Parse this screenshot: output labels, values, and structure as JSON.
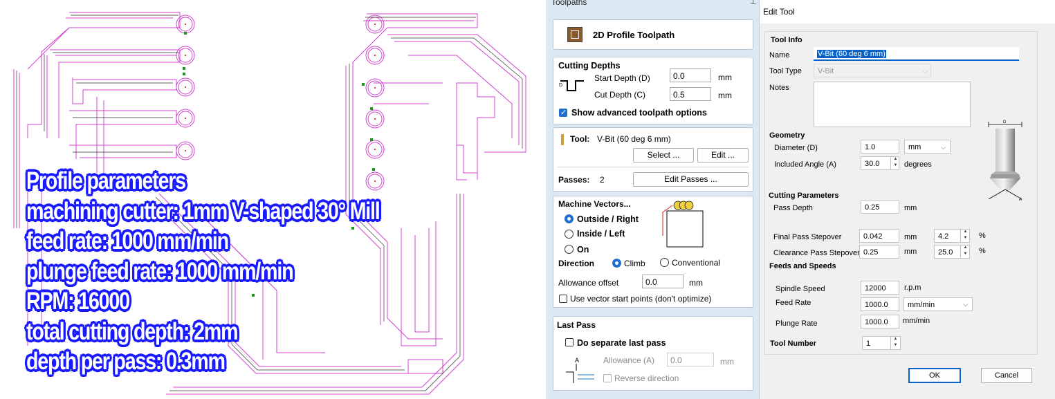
{
  "overlay": {
    "lines": [
      "Profile parameters",
      "machining cutter: 1mm V-shaped 30° Mill",
      "feed rate: 1000 mm/min",
      "plunge feed rate: 1000 mm/min",
      "RPM: 16000",
      "total cutting depth: 2mm",
      "depth per pass: 0.3mm"
    ]
  },
  "toolpaths": {
    "title": "Toolpaths",
    "header_button": "2D Profile Toolpath",
    "cutting_depths": {
      "heading": "Cutting Depths",
      "start_depth_label": "Start Depth (D)",
      "start_depth_value": "0.0",
      "cut_depth_label": "Cut Depth (C)",
      "cut_depth_value": "0.5",
      "unit": "mm",
      "advanced_label": "Show advanced toolpath options",
      "advanced_checked": true
    },
    "tool": {
      "label": "Tool:",
      "value": "V-Bit (60 deg 6 mm)",
      "select_button": "Select ...",
      "edit_button": "Edit ...",
      "passes_label": "Passes:",
      "passes_value": "2",
      "edit_passes_button": "Edit Passes ..."
    },
    "machine_vectors": {
      "heading": "Machine Vectors...",
      "outside": "Outside / Right",
      "inside": "Inside / Left",
      "on": "On",
      "direction_label": "Direction",
      "climb": "Climb",
      "conventional": "Conventional",
      "allowance_label": "Allowance offset",
      "allowance_value": "0.0",
      "unit": "mm",
      "vector_start_label": "Use vector start points (don't optimize)"
    },
    "last_pass": {
      "heading": "Last Pass",
      "separate_label": "Do separate last pass",
      "allowance_label": "Allowance (A)",
      "allowance_value": "0.0",
      "unit": "mm",
      "reverse_label": "Reverse direction"
    }
  },
  "edit_tool": {
    "title": "Edit Tool",
    "tool_info": {
      "heading": "Tool Info",
      "name_label": "Name",
      "name_value": "V-Bit (60 deg 6 mm)",
      "type_label": "Tool Type",
      "type_value": "V-Bit",
      "notes_label": "Notes"
    },
    "geometry": {
      "heading": "Geometry",
      "diameter_label": "Diameter (D)",
      "diameter_value": "1.0",
      "diameter_unit": "mm",
      "angle_label": "Included Angle (A)",
      "angle_value": "30.0",
      "angle_unit": "degrees",
      "diagram_d": "D",
      "diagram_a": "A"
    },
    "cutting_parameters": {
      "heading": "Cutting Parameters",
      "pass_depth_label": "Pass Depth",
      "pass_depth_value": "0.25",
      "final_label": "Final Pass Stepover",
      "final_value": "0.042",
      "final_pct": "4.2",
      "clearance_label": "Clearance Pass Stepover",
      "clearance_value": "0.25",
      "clearance_pct": "25.0",
      "mm": "mm",
      "pct": "%"
    },
    "feeds": {
      "heading": "Feeds and Speeds",
      "spindle_label": "Spindle Speed",
      "spindle_value": "12000",
      "spindle_unit": "r.p.m",
      "feed_label": "Feed Rate",
      "feed_value": "1000.0",
      "feed_unit": "mm/min",
      "plunge_label": "Plunge Rate",
      "plunge_value": "1000.0",
      "plunge_unit": "mm/min"
    },
    "tool_number": {
      "label": "Tool Number",
      "value": "1"
    },
    "ok": "OK",
    "cancel": "Cancel"
  },
  "colors": {
    "toolpath": "#d040d0",
    "vector": "#303030",
    "overlay_outline": "#1a1aff",
    "panel_bg": "#dce8f4",
    "accent": "#1f6fd0"
  }
}
